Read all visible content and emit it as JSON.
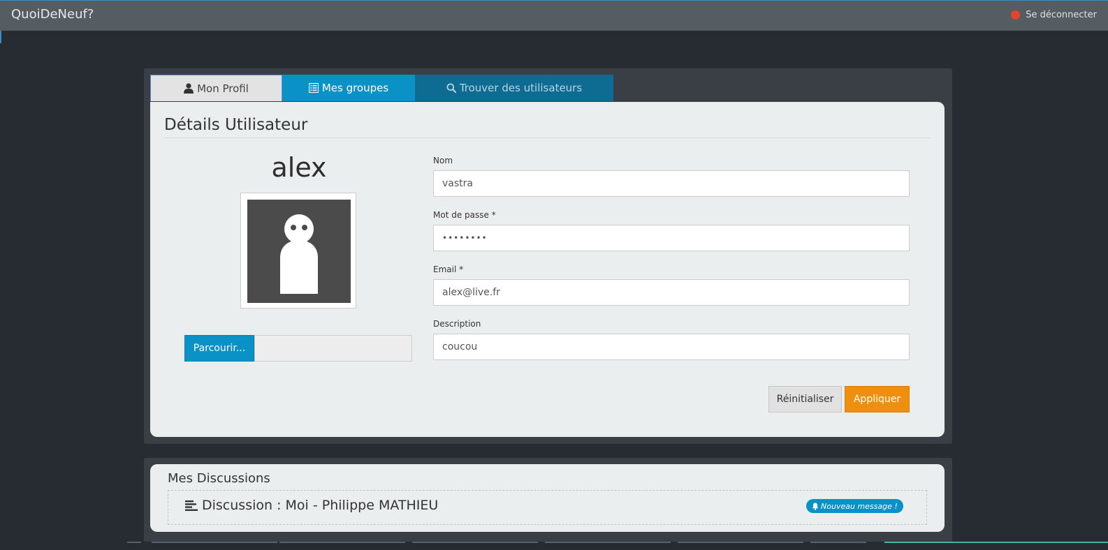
{
  "navbar": {
    "brand": "QuoiDeNeuf?",
    "logout_label": "Se déconnecter",
    "logout_dot_color": "#e8412c"
  },
  "tabs": [
    {
      "label": "Mon Profil",
      "icon": "user-icon"
    },
    {
      "label": "Mes groupes",
      "icon": "list-icon"
    },
    {
      "label": "Trouver des utilisateurs",
      "icon": "search-icon"
    }
  ],
  "profile": {
    "title": "Détails Utilisateur",
    "username": "alex",
    "avatar_icon": "default-avatar-icon",
    "browse_label": "Parcourir...",
    "fields": {
      "name": {
        "label": "Nom",
        "value": "vastra"
      },
      "password": {
        "label": "Mot de passe *",
        "value": "••••••••"
      },
      "email": {
        "label": "Email *",
        "value": "alex@live.fr"
      },
      "description": {
        "label": "Description",
        "value": "coucou"
      }
    },
    "reset_label": "Réinitialiser",
    "apply_label": "Appliquer"
  },
  "discussions": {
    "title": "Mes Discussions",
    "items": [
      {
        "label": "Discussion : Moi - Philippe MATHIEU",
        "icon": "align-left-icon",
        "badge": "Nouveau message !",
        "badge_icon": "bell-icon"
      }
    ]
  },
  "colors": {
    "accent_blue": "#0a92c7",
    "accent_orange": "#ef8f0f",
    "background": "#272c33"
  }
}
